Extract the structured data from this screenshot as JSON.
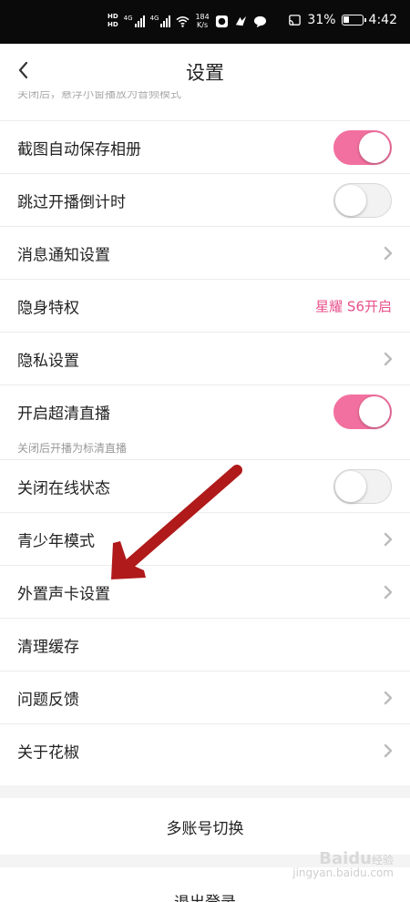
{
  "status": {
    "hd1": "HD",
    "hd2": "HD",
    "net1": "4G",
    "net2": "4G",
    "speed": "184",
    "speed_unit": "K/s",
    "battery": "31%",
    "time": "4:42"
  },
  "nav": {
    "title": "设置"
  },
  "hint_top": "关闭后，悬浮小窗播放为音频模式",
  "rows": [
    {
      "label": "截图自动保存相册",
      "type": "toggle",
      "on": true
    },
    {
      "label": "跳过开播倒计时",
      "type": "toggle",
      "on": false
    },
    {
      "label": "消息通知设置",
      "type": "chevron"
    },
    {
      "label": "隐身特权",
      "type": "value",
      "value": "星耀 S6开启"
    },
    {
      "label": "隐私设置",
      "type": "chevron"
    },
    {
      "label": "开启超清直播",
      "type": "toggle",
      "on": true,
      "sub": "关闭后开播为标清直播"
    },
    {
      "label": "关闭在线状态",
      "type": "toggle",
      "on": false
    },
    {
      "label": "青少年模式",
      "type": "chevron"
    },
    {
      "label": "外置声卡设置",
      "type": "chevron"
    },
    {
      "label": "清理缓存",
      "type": "none"
    },
    {
      "label": "问题反馈",
      "type": "chevron"
    },
    {
      "label": "关于花椒",
      "type": "chevron"
    }
  ],
  "actions": {
    "switch_account": "多账号切换",
    "logout": "退出登录"
  },
  "watermark": {
    "logo": "Baidu",
    "text": "经验",
    "sub": "jingyan.baidu.com"
  },
  "colors": {
    "accent": "#f2709f",
    "value_text": "#e8508a",
    "arrow": "#b01a1a"
  }
}
